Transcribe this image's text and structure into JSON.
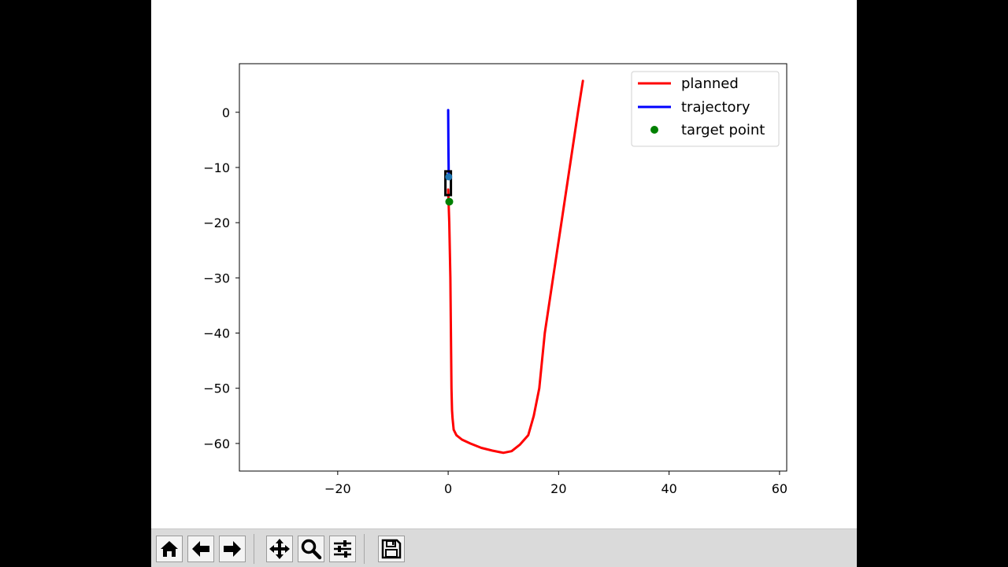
{
  "colors": {
    "planned": "#ff0000",
    "trajectory": "#0000ff",
    "target_point": "#008000",
    "vehicle_box": "#000000",
    "vehicle_marker": "#1f77b4"
  },
  "toolbar": {
    "buttons": [
      {
        "name": "home-icon",
        "tooltip": "Home"
      },
      {
        "name": "back-icon",
        "tooltip": "Back"
      },
      {
        "name": "forward-icon",
        "tooltip": "Forward"
      },
      {
        "name": "pan-icon",
        "tooltip": "Pan"
      },
      {
        "name": "zoom-icon",
        "tooltip": "Zoom"
      },
      {
        "name": "configure-subplots-icon",
        "tooltip": "Configure subplots"
      },
      {
        "name": "save-icon",
        "tooltip": "Save"
      }
    ]
  },
  "chart_data": {
    "type": "line",
    "title": "",
    "xlabel": "",
    "ylabel": "",
    "xlim": [
      -37.8,
      61.3
    ],
    "ylim": [
      -65.0,
      8.8
    ],
    "xticks": [
      -20,
      0,
      20,
      40,
      60
    ],
    "yticks": [
      0,
      -10,
      -20,
      -30,
      -40,
      -50,
      -60
    ],
    "xtick_labels": [
      "−20",
      "0",
      "20",
      "40",
      "60"
    ],
    "ytick_labels": [
      "0",
      "−10",
      "−20",
      "−30",
      "−40",
      "−50",
      "−60"
    ],
    "grid": false,
    "legend_position": "top-right",
    "legend": [
      "planned",
      "trajectory",
      "target point"
    ],
    "series": [
      {
        "name": "planned",
        "style": "line",
        "x": [
          0.0,
          0.2,
          0.4,
          0.5,
          0.6,
          0.7,
          0.8,
          0.9,
          1.0,
          1.5,
          2.5,
          4.0,
          6.0,
          8.0,
          10.0,
          11.5,
          13.0,
          14.5,
          15.5,
          16.5,
          17.5,
          19.0,
          20.5,
          22.0,
          23.5,
          24.4
        ],
        "y": [
          -14.0,
          -20.0,
          -30.0,
          -40.0,
          -50.0,
          -54.0,
          -55.5,
          -56.5,
          -57.5,
          -58.5,
          -59.3,
          -60.0,
          -60.8,
          -61.3,
          -61.7,
          -61.4,
          -60.2,
          -58.5,
          -55.0,
          -50.0,
          -40.0,
          -30.0,
          -20.0,
          -10.0,
          0.0,
          5.7
        ]
      },
      {
        "name": "trajectory",
        "style": "line",
        "x": [
          0.0,
          0.05,
          0.1
        ],
        "y": [
          0.4,
          -6.0,
          -11.5
        ]
      },
      {
        "name": "target point",
        "style": "marker",
        "x": [
          0.2
        ],
        "y": [
          -16.2
        ]
      }
    ],
    "vehicle": {
      "x_range": [
        -0.5,
        0.5
      ],
      "y_range": [
        -15.0,
        -10.7
      ],
      "marker_x": 0.1,
      "marker_y": -11.7
    }
  }
}
